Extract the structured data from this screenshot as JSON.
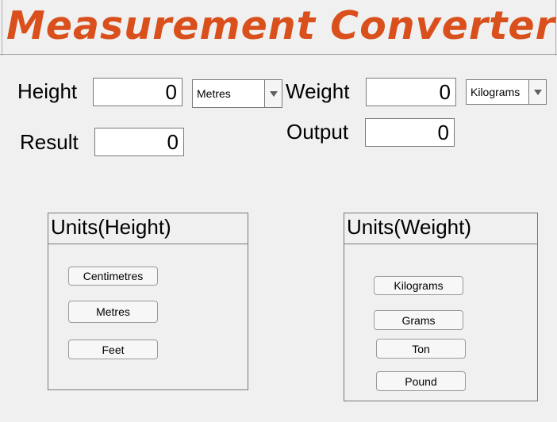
{
  "app": {
    "title": "Measurement Converter"
  },
  "height": {
    "label": "Height",
    "value": "0",
    "unit": "Metres"
  },
  "weight": {
    "label": "Weight",
    "value": "0",
    "unit": "Kilograms"
  },
  "result": {
    "label": "Result",
    "value": "0"
  },
  "output": {
    "label": "Output",
    "value": "0"
  },
  "units_height": {
    "title": "Units(Height)",
    "buttons": [
      "Centimetres",
      "Metres",
      "Feet"
    ]
  },
  "units_weight": {
    "title": "Units(Weight)",
    "buttons": [
      "Kilograms",
      "Grams",
      "Ton",
      "Pound"
    ]
  },
  "icons": {
    "dropdown": "chevron-down-icon"
  }
}
